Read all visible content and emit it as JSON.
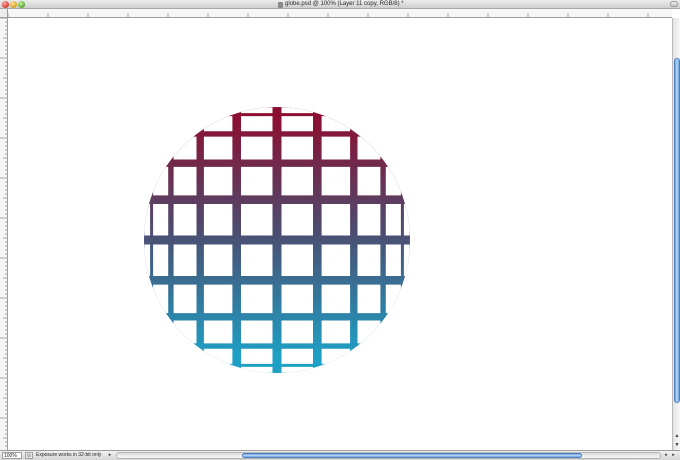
{
  "window": {
    "title": "globe.psd @ 100% (Layer 11 copy, RGB/8) *"
  },
  "status": {
    "zoom": "100%",
    "info_text": "Exposure works in 32-bit only"
  },
  "globe": {
    "top_color": "#8c0f31",
    "middle_color": "#4a4f72",
    "bottom_color": "#1e9fc4"
  },
  "icons": {
    "close": "close-icon",
    "minimize": "minimize-icon",
    "zoom": "zoom-icon",
    "document": "document-icon"
  }
}
